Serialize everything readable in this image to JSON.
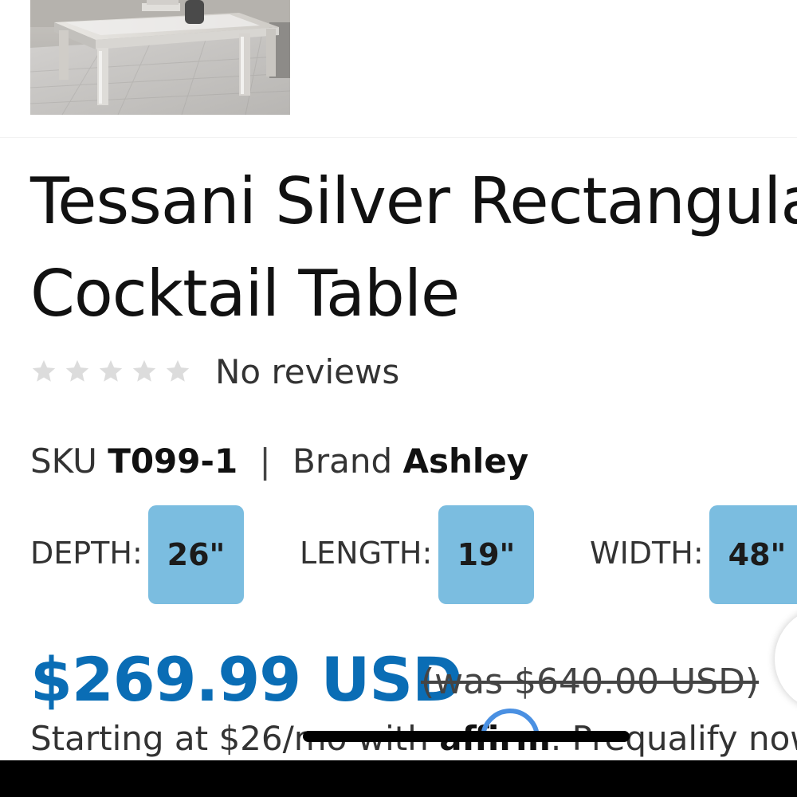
{
  "product": {
    "title_line1": "Tessani Silver Rectangular",
    "title_line2": "Cocktail Table",
    "reviews_label": "No reviews",
    "rating": 0,
    "rating_max": 5,
    "sku_label": "SKU",
    "sku_value": "T099-1",
    "separator": "|",
    "brand_label": "Brand",
    "brand_value": "Ashley"
  },
  "dimensions": [
    {
      "label": "DEPTH:",
      "value": "26\""
    },
    {
      "label": "LENGTH:",
      "value": "19\""
    },
    {
      "label": "WIDTH:",
      "value": "48\""
    }
  ],
  "pricing": {
    "price": "$269.99 USD",
    "was_price": "(was $640.00 USD)",
    "financing_prefix": "Starting at $26/mo with",
    "financing_brand": "affirm",
    "financing_suffix": ". Prequalify now"
  },
  "colors": {
    "price": "#0a6db5",
    "chip_bg": "#7bbde0",
    "star_empty": "#dcdcdc",
    "affirm_arc": "#4a90e2"
  },
  "icons": {
    "star": "star-icon",
    "affirm_arc": "affirm-logo-arc"
  }
}
